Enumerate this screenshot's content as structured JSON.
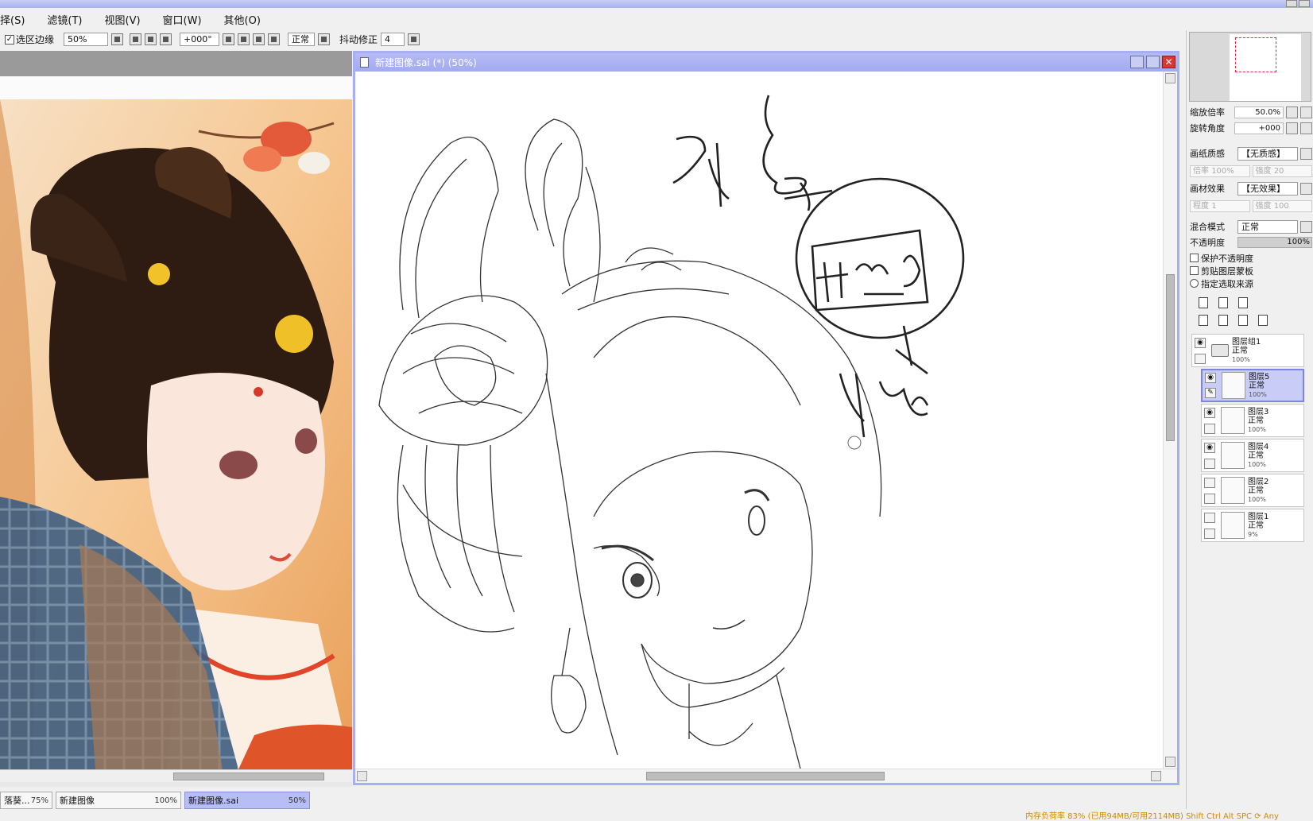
{
  "menu": [
    "择(S)",
    "滤镜(T)",
    "视图(V)",
    "窗口(W)",
    "其他(O)"
  ],
  "toolbar": {
    "selection_edge_label": "选区边缘",
    "zoom_value": "50%",
    "rotate_value": "+000°",
    "blend_value": "正常",
    "stabilizer_label": "抖动修正",
    "stabilizer_value": "4"
  },
  "drawing_window": {
    "title": "新建图像.sai (*) (50%)"
  },
  "doc_tabs": [
    {
      "name": "落葵...",
      "percent": "75%"
    },
    {
      "name": "新建图像",
      "percent": "100%"
    },
    {
      "name": "新建图像.sai",
      "percent": "50%",
      "active": true
    }
  ],
  "status": "内存负荷率 83% (已用94MB/可用2114MB)  Shift Ctrl Alt SPC ⟳ Any",
  "right_panel": {
    "zoom_label": "缩放倍率",
    "zoom_value": "50.0%",
    "rotate_label": "旋转角度",
    "rotate_value": "+000",
    "paper_texture_label": "画纸质感",
    "paper_texture_value": "【无质感】",
    "paper_texture_sub1": "倍率",
    "paper_texture_sub1_val": "100%",
    "paper_texture_sub2": "强度",
    "paper_texture_sub2_val": "20",
    "material_label": "画材效果",
    "material_value": "【无效果】",
    "material_sub1": "程度",
    "material_sub1_val": "1",
    "material_sub2": "强度",
    "material_sub2_val": "100",
    "blend_label": "混合模式",
    "blend_value": "正常",
    "opacity_label": "不透明度",
    "opacity_value": "100%",
    "protect_opacity": "保护不透明度",
    "clip_group": "剪贴图层蒙板",
    "selection_source": "指定选取来源"
  },
  "layers": [
    {
      "name": "图层组1",
      "mode": "正常",
      "opacity": "100%",
      "group": true
    },
    {
      "name": "图层5",
      "mode": "正常",
      "opacity": "100%",
      "selected": true
    },
    {
      "name": "图层3",
      "mode": "正常",
      "opacity": "100%"
    },
    {
      "name": "图层4",
      "mode": "正常",
      "opacity": "100%"
    },
    {
      "name": "图层2",
      "mode": "正常",
      "opacity": "100%"
    },
    {
      "name": "图层1",
      "mode": "正常",
      "opacity": "9%"
    }
  ],
  "canvas_handwriting": "孙佳 丑 阿 指 陈"
}
